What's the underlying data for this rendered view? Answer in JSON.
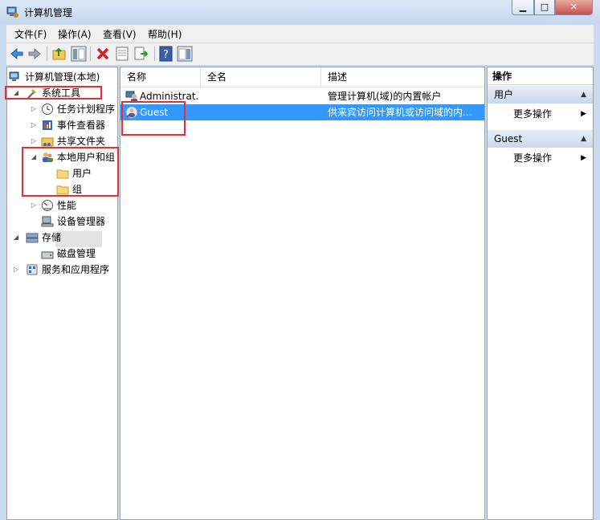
{
  "window": {
    "title": "计算机管理"
  },
  "menu": [
    "文件(F)",
    "操作(A)",
    "查看(V)",
    "帮助(H)"
  ],
  "toolbar_icons": [
    "back-icon",
    "forward-icon",
    "up-folder-icon",
    "show-hide-tree-icon",
    "delete-icon",
    "properties-icon",
    "export-list-icon",
    "help-icon",
    "show-action-pane-icon"
  ],
  "tree": {
    "root": "计算机管理(本地)",
    "system_tools": "系统工具",
    "task_scheduler": "任务计划程序",
    "event_viewer": "事件查看器",
    "shared_folders": "共享文件夹",
    "local_users_groups": "本地用户和组",
    "users": "用户",
    "groups": "组",
    "performance": "性能",
    "device_manager": "设备管理器",
    "storage": "存储",
    "disk_management": "磁盘管理",
    "services_apps": "服务和应用程序"
  },
  "list": {
    "columns": [
      "名称",
      "全名",
      "描述"
    ],
    "rows": [
      {
        "name": "Administrat...",
        "full_name": "",
        "description": "管理计算机(域)的内置帐户"
      },
      {
        "name": "Guest",
        "full_name": "",
        "description": "供来宾访问计算机或访问域的内..."
      }
    ]
  },
  "actions": {
    "title": "操作",
    "group1": "用户",
    "more1": "更多操作",
    "group2": "Guest",
    "more2": "更多操作"
  },
  "colors": {
    "selection": "#3399ff",
    "highlight_box": "#e0303a"
  }
}
